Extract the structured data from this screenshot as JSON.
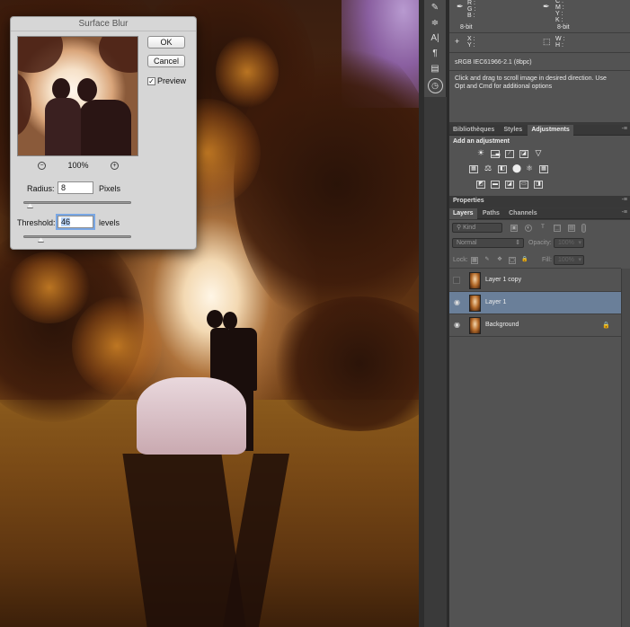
{
  "dialog": {
    "title": "Surface Blur",
    "ok_label": "OK",
    "cancel_label": "Cancel",
    "preview_label": "Preview",
    "preview_checked": true,
    "zoom_out_icon": "zoom-out-icon",
    "zoom_in_icon": "zoom-in-icon",
    "zoom": "100%",
    "radius_label": "Radius:",
    "radius_value": "8",
    "radius_unit": "Pixels",
    "threshold_label": "Threshold:",
    "threshold_value": "46",
    "threshold_unit": "levels"
  },
  "info": {
    "rgb": [
      "R :",
      "G :",
      "B :"
    ],
    "cmyk": [
      "C :",
      "M :",
      "Y :",
      "K :"
    ],
    "bits_left": "8-bit",
    "bits_right": "8-bit",
    "xy": [
      "X :",
      "Y :"
    ],
    "wh": [
      "W :",
      "H :"
    ],
    "profile": "sRGB IEC61966-2.1 (8bpc)",
    "hint_line1": "Click and drag to scroll image in desired direction.  Use",
    "hint_line2": "Opt and Cmd for additional options"
  },
  "adjust_tabs": [
    "Bibliothèques",
    "Styles",
    "Adjustments"
  ],
  "adjust": {
    "title": "Add an adjustment"
  },
  "properties_title": "Properties",
  "layers_tabs": [
    "Layers",
    "Paths",
    "Channels"
  ],
  "layers": {
    "filter_kind": "Kind",
    "blend_mode": "Normal",
    "opacity_label": "Opacity:",
    "opacity_value": "100%",
    "lock_label": "Lock:",
    "fill_label": "Fill:",
    "fill_value": "100%",
    "items": [
      {
        "name": "Layer 1 copy",
        "visible": false,
        "selected": false
      },
      {
        "name": "Layer 1",
        "visible": true,
        "selected": true
      },
      {
        "name": "Background",
        "visible": true,
        "selected": false,
        "locked": true
      }
    ]
  },
  "colors": {
    "panel_bg": "#535353",
    "selected_layer": "#6a7f99",
    "dialog_bg": "#d6d6d6"
  }
}
